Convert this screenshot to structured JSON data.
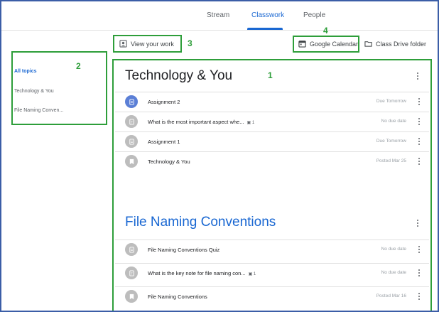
{
  "nav": {
    "tabs": [
      {
        "label": "Stream"
      },
      {
        "label": "Classwork"
      },
      {
        "label": "People"
      }
    ]
  },
  "annotations": {
    "main": "1",
    "sidebar": "2",
    "view_work": "3",
    "calendar": "4"
  },
  "toolbar": {
    "view_work_label": "View your work",
    "calendar_label": "Google Calendar",
    "drive_label": "Class Drive folder"
  },
  "sidebar": {
    "items": [
      {
        "label": "All topics"
      },
      {
        "label": "Technology & You"
      },
      {
        "label": "File Naming Conven..."
      }
    ]
  },
  "topics": [
    {
      "title": "Technology & You",
      "items": [
        {
          "title": "Assignment 2",
          "due": "Due Tomorrow",
          "icon": "assignment-icon"
        },
        {
          "title": "What is the most important aspect whe...",
          "count": "1",
          "due": "No due date",
          "icon": "question-icon"
        },
        {
          "title": "Assignment 1",
          "due": "Due Tomorrow",
          "icon": "assignment-icon"
        },
        {
          "title": "Technology & You",
          "due": "Posted Mar 25",
          "icon": "material-icon"
        }
      ]
    },
    {
      "title": "File Naming Conventions",
      "items": [
        {
          "title": "File Naming Conventions Quiz",
          "due": "No due date",
          "icon": "assignment-icon"
        },
        {
          "title": "What is the key note for file naming con...",
          "count": "1",
          "due": "No due date",
          "icon": "question-icon"
        },
        {
          "title": "File Naming Conventions",
          "due": "Posted Mar 16",
          "icon": "material-icon"
        }
      ]
    }
  ],
  "colors": {
    "accent": "#1967d2",
    "annotation": "#2e9e3a",
    "frame": "#3b5ea7"
  }
}
